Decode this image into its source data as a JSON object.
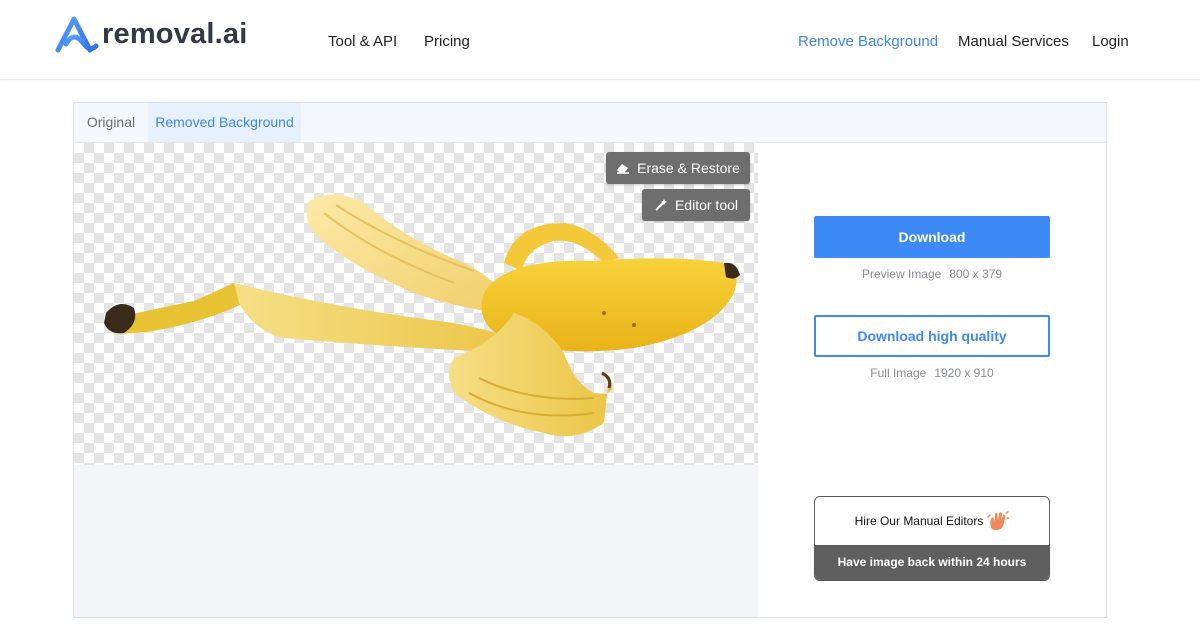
{
  "brand": {
    "name": "removal.ai",
    "accent_color": "#3d8af7"
  },
  "header": {
    "nav_left": [
      {
        "label": "Tool & API"
      },
      {
        "label": "Pricing"
      }
    ],
    "nav_right": [
      {
        "label": "Remove Background",
        "active": true
      },
      {
        "label": "Manual Services"
      },
      {
        "label": "Login"
      }
    ]
  },
  "tabs": [
    {
      "label": "Original",
      "active": false
    },
    {
      "label": "Removed Background",
      "active": true
    }
  ],
  "preview": {
    "background": "transparent-checkerboard",
    "subject": "peeled banana",
    "buttons": {
      "erase_restore": {
        "label": "Erase & Restore",
        "icon": "eraser-icon"
      },
      "editor_tool": {
        "label": "Editor tool",
        "icon": "magic-wand-icon"
      }
    }
  },
  "downloads": {
    "download": {
      "label": "Download",
      "meta_label": "Preview Image",
      "meta_size": "800 x 379"
    },
    "high_quality": {
      "label": "Download high quality",
      "meta_label": "Full Image",
      "meta_size": "1920 x 910"
    }
  },
  "hire": {
    "title": "Hire Our Manual Editors",
    "icon": "waving-hand-icon",
    "subtitle": "Have image back within 24 hours"
  }
}
